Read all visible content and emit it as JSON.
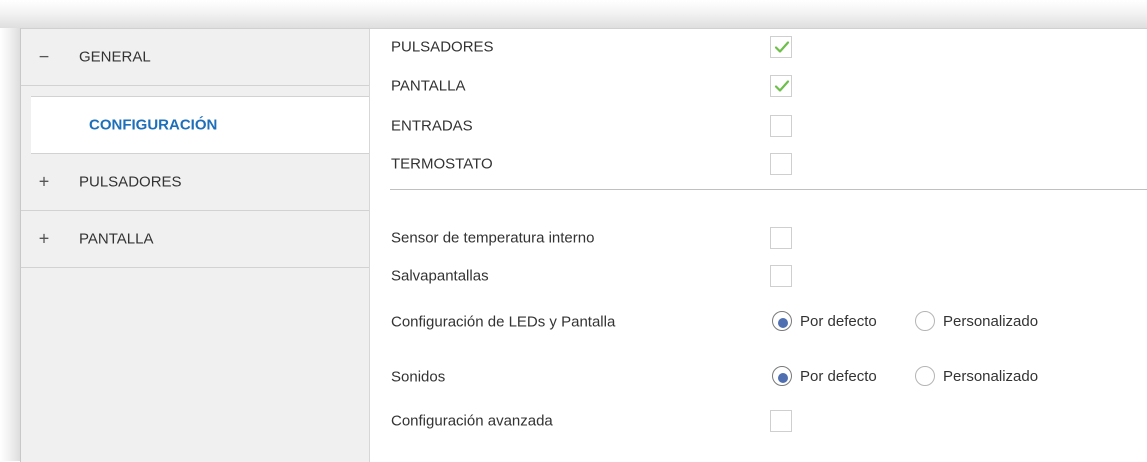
{
  "sidebar": {
    "items": [
      {
        "sign": "−",
        "label": "GENERAL",
        "expanded": true
      },
      {
        "sign": "+",
        "label": "PULSADORES",
        "expanded": false
      },
      {
        "sign": "+",
        "label": "PANTALLA",
        "expanded": false
      }
    ],
    "sub_item": {
      "label": "CONFIGURACIÓN",
      "selected": true
    }
  },
  "main": {
    "sections": [
      {
        "label": "PULSADORES",
        "checked": true
      },
      {
        "label": "PANTALLA",
        "checked": true
      },
      {
        "label": "ENTRADAS",
        "checked": false
      },
      {
        "label": "TERMOSTATO",
        "checked": false
      }
    ],
    "options": {
      "sensor_label": "Sensor de temperatura interno",
      "sensor_checked": false,
      "screensaver_label": "Salvapantallas",
      "screensaver_checked": false,
      "leds_label": "Configuración de LEDs y Pantalla",
      "leds_option_default": "Por defecto",
      "leds_option_custom": "Personalizado",
      "leds_selected": "Por defecto",
      "sounds_label": "Sonidos",
      "sounds_option_default": "Por defecto",
      "sounds_option_custom": "Personalizado",
      "sounds_selected": "Por defecto",
      "advanced_label": "Configuración avanzada",
      "advanced_checked": false
    }
  },
  "colors": {
    "accent_blue": "#1e6fb9",
    "check_green": "#6cbf4a",
    "radio_fill": "#4f6fb0",
    "sidebar_bg": "#f0f0f0"
  },
  "icons": {
    "check": "check-icon",
    "collapse": "minus-icon",
    "expand": "plus-icon"
  }
}
